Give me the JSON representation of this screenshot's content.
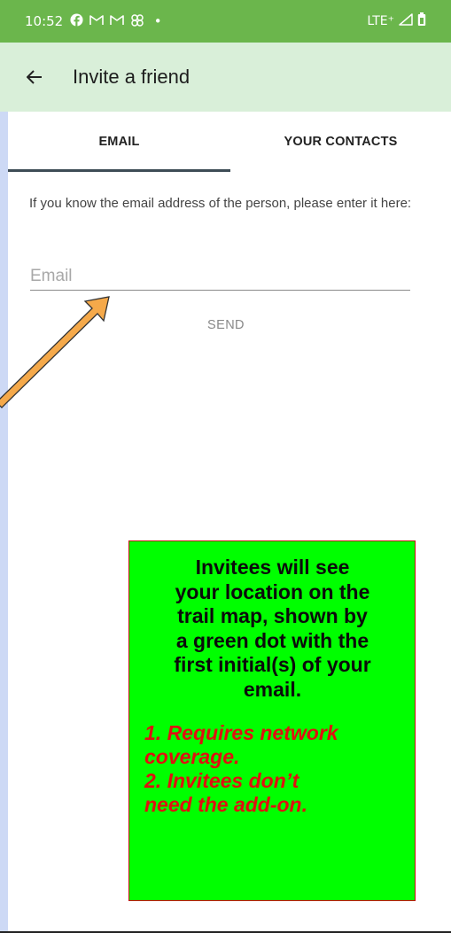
{
  "status_bar": {
    "time": "10:52",
    "icons": [
      "facebook-icon",
      "gmail-icon",
      "gmail-icon",
      "pinwheel-icon",
      "dot-icon"
    ],
    "network": "LTE⁺",
    "background_color": "#6bb64c"
  },
  "app_bar": {
    "title": "Invite a friend",
    "background_color": "#d9efd9"
  },
  "tabs": [
    {
      "label": "EMAIL",
      "selected": true
    },
    {
      "label": "YOUR CONTACTS",
      "selected": false
    }
  ],
  "email_form": {
    "instruction": "If you know the email address of the person, please enter it here:",
    "placeholder": "Email",
    "value": "",
    "send_label": "SEND"
  },
  "annotation": {
    "arrow_color": "#f5a94a",
    "callout_background": "#00ff00",
    "callout_border": "#c81010",
    "main_lines": [
      "Invitees will see",
      "your location on the",
      "trail map, shown by",
      "a green dot with the",
      "first initial(s) of your",
      "email."
    ],
    "notes": [
      "1. Requires network",
      "coverage.",
      "2. Invitees don’t",
      "need the add-on."
    ],
    "notes_color": "#e01010"
  }
}
